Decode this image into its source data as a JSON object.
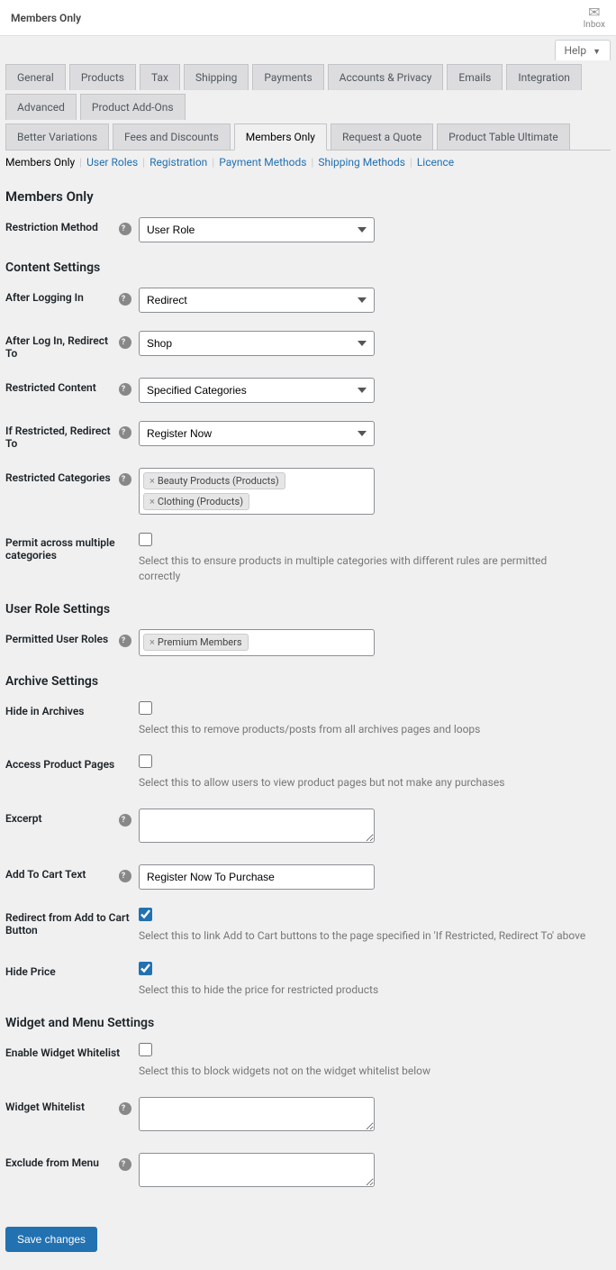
{
  "topbar": {
    "title": "Members Only",
    "inbox": "Inbox",
    "help": "Help"
  },
  "tabs": {
    "row1": [
      "General",
      "Products",
      "Tax",
      "Shipping",
      "Payments",
      "Accounts & Privacy",
      "Emails",
      "Integration",
      "Advanced",
      "Product Add-Ons"
    ],
    "row2": [
      "Better Variations",
      "Fees and Discounts",
      "Members Only",
      "Request a Quote",
      "Product Table Ultimate"
    ],
    "active": "Members Only"
  },
  "subnav": {
    "current": "Members Only",
    "links": [
      "User Roles",
      "Registration",
      "Payment Methods",
      "Shipping Methods",
      "Licence"
    ]
  },
  "sections": {
    "main_title": "Members Only",
    "restriction": {
      "label": "Restriction Method",
      "value": "User Role"
    },
    "content_settings": "Content Settings",
    "after_login": {
      "label": "After Logging In",
      "value": "Redirect"
    },
    "after_login_redirect": {
      "label": "After Log In, Redirect To",
      "value": "Shop"
    },
    "restricted_content": {
      "label": "Restricted Content",
      "value": "Specified Categories"
    },
    "if_restricted": {
      "label": "If Restricted, Redirect To",
      "value": "Register Now"
    },
    "restricted_categories": {
      "label": "Restricted Categories",
      "tags": [
        "Beauty Products (Products)",
        "Clothing (Products)"
      ]
    },
    "permit_multi": {
      "label": "Permit across multiple categories",
      "desc": "Select this to ensure products in multiple categories with different rules are permitted correctly"
    },
    "user_role_settings": "User Role Settings",
    "permitted_roles": {
      "label": "Permitted User Roles",
      "tags": [
        "Premium Members"
      ]
    },
    "archive_settings": "Archive Settings",
    "hide_archives": {
      "label": "Hide in Archives",
      "desc": "Select this to remove products/posts from all archives pages and loops"
    },
    "access_product": {
      "label": "Access Product Pages",
      "desc": "Select this to allow users to view product pages but not make any purchases"
    },
    "excerpt": {
      "label": "Excerpt"
    },
    "add_to_cart_text": {
      "label": "Add To Cart Text",
      "value": "Register Now To Purchase"
    },
    "redirect_cart": {
      "label": "Redirect from Add to Cart Button",
      "desc": "Select this to link Add to Cart buttons to the page specified in 'If Restricted, Redirect To' above"
    },
    "hide_price": {
      "label": "Hide Price",
      "desc": "Select this to hide the price for restricted products"
    },
    "widget_settings": "Widget and Menu Settings",
    "enable_widget": {
      "label": "Enable Widget Whitelist",
      "desc": "Select this to block widgets not on the widget whitelist below"
    },
    "widget_whitelist": {
      "label": "Widget Whitelist"
    },
    "exclude_menu": {
      "label": "Exclude from Menu"
    },
    "save": "Save changes"
  }
}
